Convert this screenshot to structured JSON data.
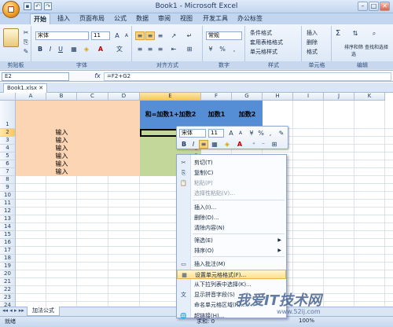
{
  "window": {
    "title": "Book1 - Microsoft Excel"
  },
  "tabs": [
    "开始",
    "插入",
    "页面布局",
    "公式",
    "数据",
    "审阅",
    "视图",
    "开发工具",
    "办公标签"
  ],
  "ribbon": {
    "clipboard_label": "剪贴板",
    "font_label": "字体",
    "align_label": "对齐方式",
    "number_label": "数字",
    "styles_label": "样式",
    "cells_label": "单元格",
    "editing_label": "编辑",
    "font_name": "宋体",
    "font_size": "11",
    "number_format": "常规",
    "percent": "%",
    "cond_format": "条件格式",
    "table_format": "套用表格格式",
    "cell_style": "单元格样式",
    "insert": "插入",
    "delete": "删除",
    "format": "格式",
    "sort_filter": "排序和筛选",
    "find_select": "查找和选择"
  },
  "formula_bar": {
    "name_box": "E2",
    "fx": "fx",
    "formula": "=F2+G2"
  },
  "workbook_tab": "Book1.xlsx",
  "columns": [
    "A",
    "B",
    "C",
    "D",
    "E",
    "F",
    "G",
    "H",
    "I",
    "J",
    "K"
  ],
  "rows": [
    "1",
    "2",
    "3",
    "4",
    "5",
    "6",
    "7",
    "8",
    "9",
    "10",
    "11",
    "12",
    "13",
    "14",
    "15",
    "16",
    "17",
    "18",
    "19",
    "20",
    "21",
    "22",
    "23",
    "24",
    "25",
    "26"
  ],
  "headers": {
    "e1": "和=加数1+加数2",
    "f1": "加数1",
    "g1": "加数2"
  },
  "inputs": [
    "输入",
    "输入",
    "输入",
    "输入",
    "输入",
    "输入"
  ],
  "e_values": [
    "0",
    "0",
    "0",
    "0",
    "0",
    "0"
  ],
  "mini_toolbar": {
    "font": "宋体",
    "size": "11"
  },
  "context_menu": [
    {
      "label": "剪切(T)",
      "icon": "scissors-icon",
      "glyph": "✂",
      "disabled": false
    },
    {
      "label": "复制(C)",
      "icon": "copy-icon",
      "glyph": "⎘",
      "disabled": false
    },
    {
      "label": "粘贴(P)",
      "icon": "paste-icon",
      "glyph": "📋",
      "disabled": true
    },
    {
      "label": "选择性粘贴(V)...",
      "icon": "",
      "glyph": "",
      "disabled": true
    },
    {
      "label": "插入(I)...",
      "icon": "",
      "glyph": "",
      "disabled": false
    },
    {
      "label": "删除(D)...",
      "icon": "",
      "glyph": "",
      "disabled": false
    },
    {
      "label": "清除内容(N)",
      "icon": "",
      "glyph": "",
      "disabled": false
    },
    {
      "label": "筛选(E)",
      "icon": "",
      "glyph": "",
      "disabled": false
    },
    {
      "label": "排序(O)",
      "icon": "",
      "glyph": "",
      "disabled": false
    },
    {
      "label": "插入批注(M)",
      "icon": "comment-icon",
      "glyph": "▭",
      "disabled": false
    },
    {
      "label": "设置单元格格式(F)...",
      "icon": "format-cells-icon",
      "glyph": "▦",
      "disabled": false
    },
    {
      "label": "从下拉列表中选择(K)...",
      "icon": "",
      "glyph": "",
      "disabled": false
    },
    {
      "label": "显示拼音字段(S)",
      "icon": "phonetic-icon",
      "glyph": "文",
      "disabled": false
    },
    {
      "label": "命名单元格区域(R)...",
      "icon": "",
      "glyph": "",
      "disabled": false
    },
    {
      "label": "超链接(H)...",
      "icon": "hyperlink-icon",
      "glyph": "🌐",
      "disabled": false
    }
  ],
  "sheet_tab": "加法公式",
  "status": {
    "ready": "就绪",
    "sum": "求和: 0",
    "zoom": "100%"
  },
  "watermark": {
    "text": "我爱IT技术网",
    "url": "www.52ij.com"
  },
  "colors": {
    "input_fill": "#fcd5b4",
    "header_fill": "#558ed5",
    "result_fill": "#c4d79b",
    "ribbon": "#dbe6f5",
    "menu_highlight": "#ffe08a"
  }
}
